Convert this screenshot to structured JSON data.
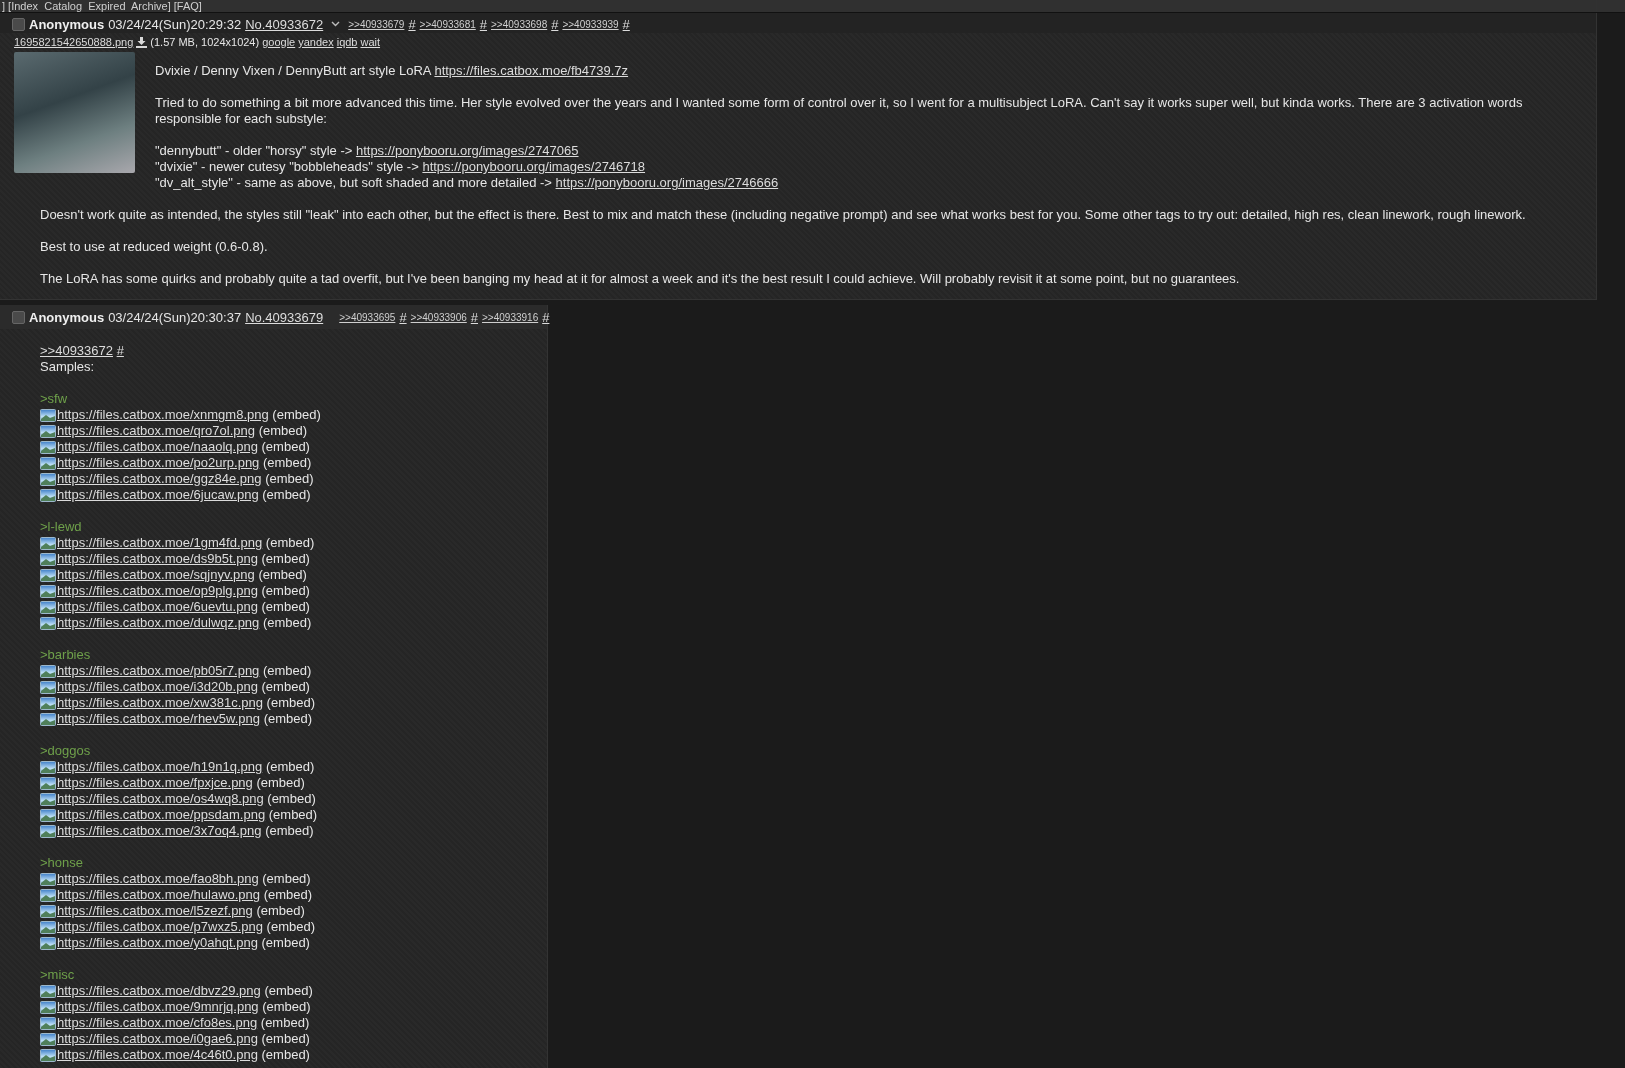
{
  "nav": {
    "text": "] [Index  Catalog  Expired  Archive] [FAQ]"
  },
  "posts": [
    {
      "checked": false,
      "name": "Anonymous",
      "datetime": "03/24/24(Sun)20:29:32",
      "number": "No.40933672",
      "backlinks": [
        {
          "link": ">>40933679",
          "hash": "#"
        },
        {
          "link": ">>40933681",
          "hash": "#"
        },
        {
          "link": ">>40933698",
          "hash": "#"
        },
        {
          "link": ">>40933939",
          "hash": "#"
        }
      ],
      "file": {
        "name": "1695821542650888.png",
        "info": "(1.57 MB, 1024x1024)",
        "search_links": [
          "google",
          "yandex",
          "iqdb",
          "wait"
        ]
      },
      "message": [
        {
          "kind": "text",
          "text": "Dvixie / Denny Vixen / DennyButt art style LoRA ",
          "link": "https://files.catbox.moe/fb4739.7z"
        },
        {
          "kind": "gap"
        },
        {
          "kind": "text",
          "text": "Tried to do something a bit more advanced this time. Her style evolved over the years and I wanted some form of control over it, so I went for a multisubject LoRA. Can't say it works super well, but kinda works. There are 3 activation words responsible for each substyle:"
        },
        {
          "kind": "gap"
        },
        {
          "kind": "text",
          "text": "\"dennybutt\" - older \"horsy\" style -> ",
          "link": "https://ponybooru.org/images/2747065"
        },
        {
          "kind": "text",
          "text": "\"dvixie\" - newer cutesy \"bobbleheads\" style -> ",
          "link": "https://ponybooru.org/images/2746718"
        },
        {
          "kind": "text",
          "text": "\"dv_alt_style\" - same as above, but soft shaded and more detailed -> ",
          "link": "https://ponybooru.org/images/2746666"
        },
        {
          "kind": "gap"
        },
        {
          "kind": "text",
          "text": "Doesn't work quite as intended, the styles still \"leak\" into each other, but the effect is there. Best to mix and match these (including negative prompt) and see what works best for you. Some other tags to try out: detailed, high res, clean linework, rough linework."
        },
        {
          "kind": "gap"
        },
        {
          "kind": "text",
          "text": "Best to use at reduced weight (0.6-0.8)."
        },
        {
          "kind": "gap"
        },
        {
          "kind": "text",
          "text": "The LoRA has some quirks and probably quite a tad overfit, but I've been banging my head at it for almost a week and it's the best result I could achieve. Will probably revisit it at some point, but no guarantees."
        }
      ]
    },
    {
      "checked": false,
      "name": "Anonymous",
      "datetime": "03/24/24(Sun)20:30:37",
      "number": "No.40933679",
      "backlinks": [
        {
          "link": ">>40933695",
          "hash": "#"
        },
        {
          "link": ">>40933906",
          "hash": "#"
        },
        {
          "link": ">>40933916",
          "hash": "#"
        }
      ],
      "message": [
        {
          "kind": "quote",
          "link": ">>40933672",
          "hash": "#"
        },
        {
          "kind": "text",
          "text": "Samples:"
        },
        {
          "kind": "gap"
        },
        {
          "kind": "greentext",
          "text": ">sfw"
        },
        {
          "kind": "embed",
          "link": "https://files.catbox.moe/xnmgm8.png",
          "suffix": "(embed)"
        },
        {
          "kind": "embed",
          "link": "https://files.catbox.moe/qro7ol.png",
          "suffix": "(embed)"
        },
        {
          "kind": "embed",
          "link": "https://files.catbox.moe/naaolq.png",
          "suffix": "(embed)"
        },
        {
          "kind": "embed",
          "link": "https://files.catbox.moe/po2urp.png",
          "suffix": "(embed)"
        },
        {
          "kind": "embed",
          "link": "https://files.catbox.moe/ggz84e.png",
          "suffix": "(embed)"
        },
        {
          "kind": "embed",
          "link": "https://files.catbox.moe/6jucaw.png",
          "suffix": "(embed)"
        },
        {
          "kind": "gap"
        },
        {
          "kind": "greentext",
          "text": ">l-lewd"
        },
        {
          "kind": "embed",
          "link": "https://files.catbox.moe/1gm4fd.png",
          "suffix": "(embed)"
        },
        {
          "kind": "embed",
          "link": "https://files.catbox.moe/ds9b5t.png",
          "suffix": "(embed)"
        },
        {
          "kind": "embed",
          "link": "https://files.catbox.moe/sqjnyv.png",
          "suffix": "(embed)"
        },
        {
          "kind": "embed",
          "link": "https://files.catbox.moe/op9plg.png",
          "suffix": "(embed)"
        },
        {
          "kind": "embed",
          "link": "https://files.catbox.moe/6uevtu.png",
          "suffix": "(embed)"
        },
        {
          "kind": "embed",
          "link": "https://files.catbox.moe/dulwqz.png",
          "suffix": "(embed)"
        },
        {
          "kind": "gap"
        },
        {
          "kind": "greentext",
          "text": ">barbies"
        },
        {
          "kind": "embed",
          "link": "https://files.catbox.moe/pb05r7.png",
          "suffix": "(embed)"
        },
        {
          "kind": "embed",
          "link": "https://files.catbox.moe/i3d20b.png",
          "suffix": "(embed)"
        },
        {
          "kind": "embed",
          "link": "https://files.catbox.moe/xw381c.png",
          "suffix": "(embed)"
        },
        {
          "kind": "embed",
          "link": "https://files.catbox.moe/rhev5w.png",
          "suffix": "(embed)"
        },
        {
          "kind": "gap"
        },
        {
          "kind": "greentext",
          "text": ">doggos"
        },
        {
          "kind": "embed",
          "link": "https://files.catbox.moe/h19n1q.png",
          "suffix": "(embed)"
        },
        {
          "kind": "embed",
          "link": "https://files.catbox.moe/fpxjce.png",
          "suffix": "(embed)"
        },
        {
          "kind": "embed",
          "link": "https://files.catbox.moe/os4wq8.png",
          "suffix": "(embed)"
        },
        {
          "kind": "embed",
          "link": "https://files.catbox.moe/ppsdam.png",
          "suffix": "(embed)"
        },
        {
          "kind": "embed",
          "link": "https://files.catbox.moe/3x7oq4.png",
          "suffix": "(embed)"
        },
        {
          "kind": "gap"
        },
        {
          "kind": "greentext",
          "text": ">honse"
        },
        {
          "kind": "embed",
          "link": "https://files.catbox.moe/fao8bh.png",
          "suffix": "(embed)"
        },
        {
          "kind": "embed",
          "link": "https://files.catbox.moe/hulawo.png",
          "suffix": "(embed)"
        },
        {
          "kind": "embed",
          "link": "https://files.catbox.moe/l5zezf.png",
          "suffix": "(embed)"
        },
        {
          "kind": "embed",
          "link": "https://files.catbox.moe/p7wxz5.png",
          "suffix": "(embed)"
        },
        {
          "kind": "embed",
          "link": "https://files.catbox.moe/y0ahqt.png",
          "suffix": "(embed)"
        },
        {
          "kind": "gap"
        },
        {
          "kind": "greentext",
          "text": ">misc"
        },
        {
          "kind": "embed",
          "link": "https://files.catbox.moe/dbvz29.png",
          "suffix": "(embed)"
        },
        {
          "kind": "embed",
          "link": "https://files.catbox.moe/9mnrjq.png",
          "suffix": "(embed)"
        },
        {
          "kind": "embed",
          "link": "https://files.catbox.moe/cfo8es.png",
          "suffix": "(embed)"
        },
        {
          "kind": "embed",
          "link": "https://files.catbox.moe/i0gae6.png",
          "suffix": "(embed)"
        },
        {
          "kind": "embed",
          "link": "https://files.catbox.moe/4c46t0.png",
          "suffix": "(embed)"
        }
      ]
    }
  ]
}
